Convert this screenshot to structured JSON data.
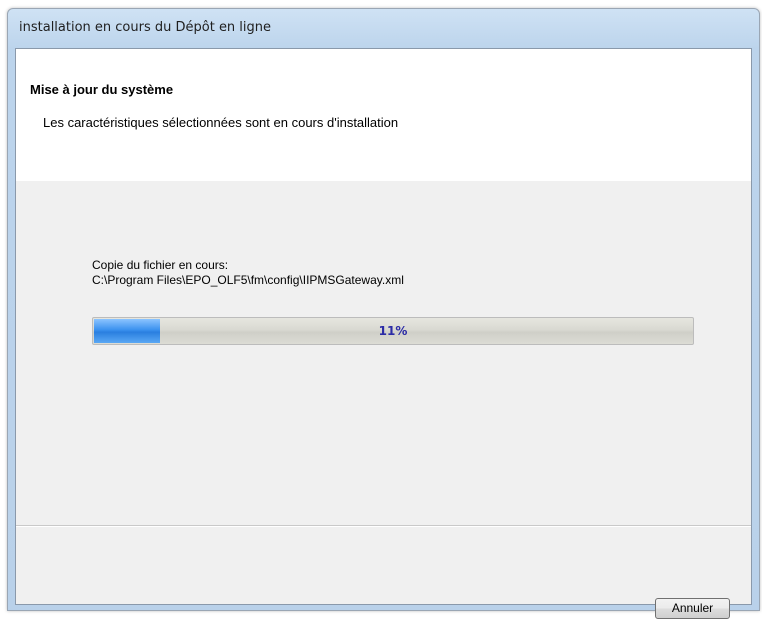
{
  "window": {
    "title": "installation en cours du Dépôt en ligne"
  },
  "header": {
    "title": "Mise à jour du système",
    "subtitle": "Les caractéristiques sélectionnées sont en cours d'installation"
  },
  "status": {
    "label": "Copie du fichier en cours:",
    "path": "C:\\Program Files\\EPO_OLF5\\fm\\config\\IIPMSGateway.xml"
  },
  "progress": {
    "percent": 11,
    "text": "11%"
  },
  "buttons": {
    "cancel_label": "Annuler"
  },
  "colors": {
    "progress_fill": "#3b92ef",
    "progress_text": "#2b2ba6",
    "title_bar": "#bcd4ec"
  }
}
